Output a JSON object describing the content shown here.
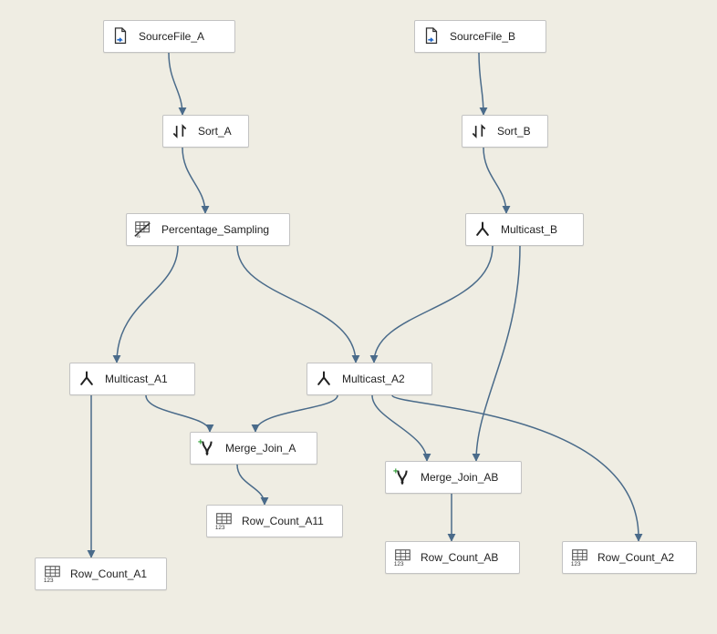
{
  "nodes": {
    "sourceA": {
      "label": "SourceFile_A",
      "icon": "file-source"
    },
    "sourceB": {
      "label": "SourceFile_B",
      "icon": "file-source"
    },
    "sortA": {
      "label": "Sort_A",
      "icon": "sort"
    },
    "sortB": {
      "label": "Sort_B",
      "icon": "sort"
    },
    "pctSamp": {
      "label": "Percentage_Sampling",
      "icon": "sampling"
    },
    "mcastB": {
      "label": "Multicast_B",
      "icon": "multicast"
    },
    "mcastA1": {
      "label": "Multicast_A1",
      "icon": "multicast"
    },
    "mcastA2": {
      "label": "Multicast_A2",
      "icon": "multicast"
    },
    "mergeA": {
      "label": "Merge_Join_A",
      "icon": "merge-join"
    },
    "mergeAB": {
      "label": "Merge_Join_AB",
      "icon": "merge-join"
    },
    "rcA11": {
      "label": "Row_Count_A11",
      "icon": "row-count"
    },
    "rcA1": {
      "label": "Row_Count_A1",
      "icon": "row-count"
    },
    "rcAB": {
      "label": "Row_Count_AB",
      "icon": "row-count"
    },
    "rcA2": {
      "label": "Row_Count_A2",
      "icon": "row-count"
    }
  },
  "edges": [
    [
      "sourceA",
      "sortA"
    ],
    [
      "sortA",
      "pctSamp"
    ],
    [
      "pctSamp",
      "mcastA1"
    ],
    [
      "pctSamp",
      "mcastA2"
    ],
    [
      "mcastA1",
      "mergeA"
    ],
    [
      "mcastA1",
      "rcA1"
    ],
    [
      "mcastA2",
      "mergeA"
    ],
    [
      "mcastA2",
      "mergeAB"
    ],
    [
      "mcastA2",
      "rcA2"
    ],
    [
      "mergeA",
      "rcA11"
    ],
    [
      "sourceB",
      "sortB"
    ],
    [
      "sortB",
      "mcastB"
    ],
    [
      "mcastB",
      "mergeAB"
    ],
    [
      "mcastB",
      "mcastA2"
    ],
    [
      "mergeAB",
      "rcAB"
    ]
  ],
  "colors": {
    "connector": "#4a6b8a",
    "nodeBorder": "#c3c3c3",
    "canvasBg": "#efede3"
  }
}
